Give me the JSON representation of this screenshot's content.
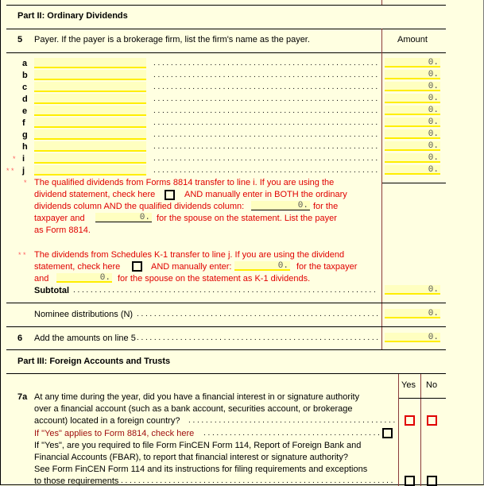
{
  "part2": {
    "title": "Part II:  Ordinary Dividends",
    "line5": {
      "number": "5",
      "text": "Payer.   If the payer is a brokerage firm,  list the firm's name as the payer.",
      "amount_header": "Amount"
    },
    "payers": [
      {
        "letter": "a",
        "star": "",
        "name": "",
        "amount": "0."
      },
      {
        "letter": "b",
        "star": "",
        "name": "",
        "amount": "0."
      },
      {
        "letter": "c",
        "star": "",
        "name": "",
        "amount": "0."
      },
      {
        "letter": "d",
        "star": "",
        "name": "",
        "amount": "0."
      },
      {
        "letter": "e",
        "star": "",
        "name": "",
        "amount": "0."
      },
      {
        "letter": "f",
        "star": "",
        "name": "",
        "amount": "0."
      },
      {
        "letter": "g",
        "star": "",
        "name": "",
        "amount": "0."
      },
      {
        "letter": "h",
        "star": "",
        "name": "",
        "amount": "0."
      },
      {
        "letter": "i",
        "star": "*",
        "name": "",
        "amount": "0."
      },
      {
        "letter": "j",
        "star": "* *",
        "name": "",
        "amount": "0."
      }
    ],
    "note1": {
      "star": "*",
      "line1": "The qualified dividends from Forms 8814 transfer to line i.  If you are using the",
      "line2a": "dividend statement,  check here",
      "line2b": "AND manually enter in BOTH the ordinary",
      "line3a": "dividends column AND the qualified dividends column:",
      "taxpayer_value": "0.",
      "line3b": "for the",
      "line4a": "taxpayer and",
      "spouse_value": "0.",
      "line4b": "for the spouse on the statement.  List the payer",
      "line5": "as Form 8814."
    },
    "note2": {
      "star": "* *",
      "line1": "The dividends from Schedules K-1 transfer to line j.  If you are using the dividend",
      "line2a": "statement,  check here",
      "line2b": "AND manually enter:",
      "taxpayer_value": "0.",
      "line2c": "for the taxpayer",
      "line3a": "and",
      "spouse_value": "0.",
      "line3b": "for the spouse on the statement as K-1 dividends."
    },
    "subtotal": {
      "label": "Subtotal",
      "amount": "0."
    },
    "nominee": {
      "label": "Nominee distributions  (N)",
      "amount": "0."
    },
    "line6": {
      "number": "6",
      "label": "Add the amounts on line 5",
      "amount": "0."
    }
  },
  "part3": {
    "title": "Part III:  Foreign Accounts and Trusts",
    "yes_label": "Yes",
    "no_label": "No",
    "line7a": {
      "number": "7a",
      "line1": "At any time during the year,  did you have a financial interest in or signature authority",
      "line2": "over a financial account  (such as a bank account,  securities account,  or brokerage",
      "line3": "account)  located in a foreign country?",
      "form8814_label": "If  \"Yes\"  applies to Form 8814,  check here",
      "fbar1": "If  \"Yes\",  are you required to file Form FinCEN Form 114,  Report of Foreign Bank and",
      "fbar2": "Financial Accounts  (FBAR),  to report that financial interest or signature authority?",
      "fbar3": "See Form FinCEN Form 114 and its instructions for filing requirements and exceptions",
      "fbar4": "to those requirements"
    }
  }
}
